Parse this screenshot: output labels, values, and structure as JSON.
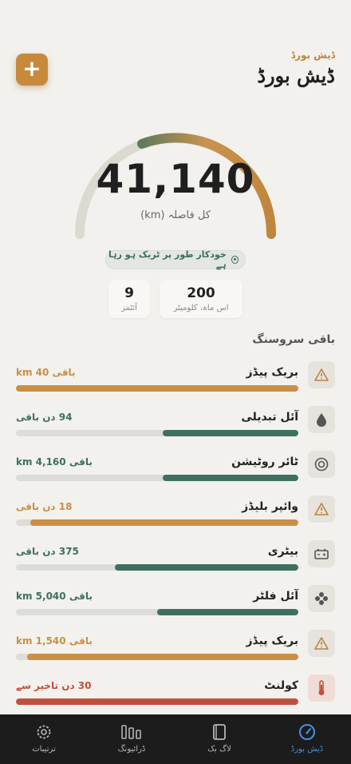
{
  "header": {
    "subtitle": "ڈیش بورڈ",
    "title": "ڈیش بورڈ",
    "add_label": "+"
  },
  "gauge": {
    "value": "41,140",
    "label": "کل فاصلہ (km)"
  },
  "tracking": {
    "label": "خودکار طور پر ٹریک ہو رہا ہے"
  },
  "stats": {
    "km_value": "200",
    "km_label": "اس ماہ، کلومیٹر",
    "items_value": "9",
    "items_label": "آئٹمز"
  },
  "section_title": "باقی سروسنگ",
  "services": [
    {
      "name": "بریک پیڈز",
      "remaining": "باقی 40 km",
      "icon": "warning-icon",
      "progress": 1.0,
      "color": "#c98f45"
    },
    {
      "name": "آئل تبدیلی",
      "remaining": "94 دن باقی",
      "icon": "oil-drop-icon",
      "progress": 0.48,
      "color": "#3e6f60"
    },
    {
      "name": "ٹائر روٹیشن",
      "remaining": "باقی 4,160 km",
      "icon": "tire-icon",
      "progress": 0.48,
      "color": "#3e6f60"
    },
    {
      "name": "وائپر بلیڈز",
      "remaining": "18 دن باقی",
      "icon": "warning-icon",
      "progress": 0.95,
      "color": "#c98f45"
    },
    {
      "name": "بیٹری",
      "remaining": "375 دن باقی",
      "icon": "battery-icon",
      "progress": 0.65,
      "color": "#3e6f60"
    },
    {
      "name": "آئل فلٹر",
      "remaining": "باقی 5,040 km",
      "icon": "filter-icon",
      "progress": 0.5,
      "color": "#3e6f60"
    },
    {
      "name": "بریک پیڈز",
      "remaining": "باقی 1,540 km",
      "icon": "warning-icon",
      "progress": 0.96,
      "color": "#c98f45"
    },
    {
      "name": "کولنٹ",
      "remaining": "30 دن تاخیر سے",
      "icon": "thermometer-icon",
      "progress": 1.0,
      "color": "#c0503c"
    }
  ],
  "tabs": [
    {
      "label": "ڈیش بورڈ",
      "icon": "gauge-icon",
      "active": true
    },
    {
      "label": "لاگ بک",
      "icon": "book-icon",
      "active": false
    },
    {
      "label": "ڈرائیونگ",
      "icon": "bars-icon",
      "active": false
    },
    {
      "label": "ترتیبات",
      "icon": "gear-icon",
      "active": false
    }
  ],
  "colors": {
    "accent": "#c68a3c",
    "green": "#3e6f60",
    "overdue": "#c0503c",
    "tab_active": "#4b8fe0"
  }
}
